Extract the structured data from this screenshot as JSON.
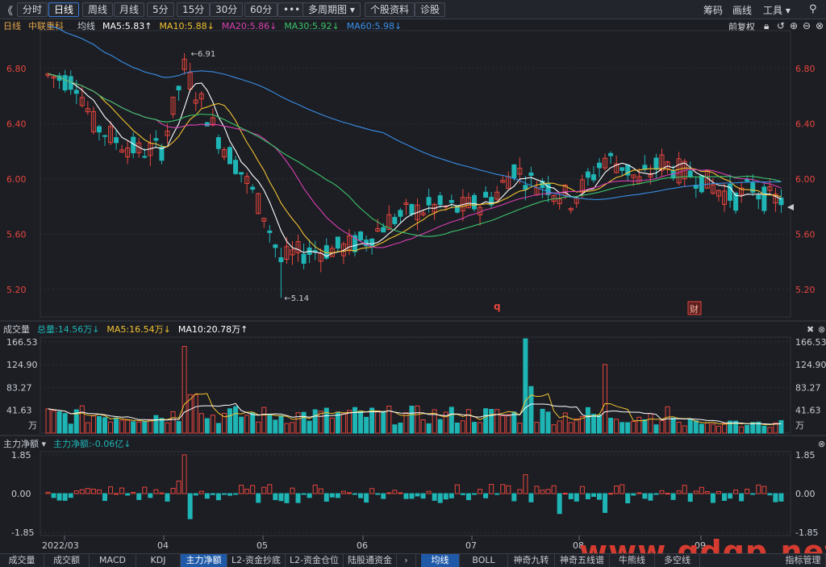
{
  "toolbar": {
    "collapse_glyph": "《",
    "left_buttons": [
      "分时",
      "日线",
      "周线",
      "月线",
      "5分",
      "15分",
      "30分",
      "60分",
      "•••",
      "多周期图 ▾",
      "个股资料",
      "诊股"
    ],
    "active_index": 1,
    "right_labels": [
      "筹码",
      "画线",
      "工具 ▾"
    ]
  },
  "price_legend": {
    "period": "日线",
    "stock_name": "中联重科",
    "ma_label": "均线",
    "ma5": "MA5:5.83↑",
    "ma10": "MA10:5.88↓",
    "ma20": "MA20:5.86↓",
    "ma30": "MA30:5.92↓",
    "ma60": "MA60:5.98↓",
    "adjust": "前复权"
  },
  "volume_legend": {
    "title": "成交量",
    "total": "总量:14.56万↓",
    "ma5": "MA5:16.54万↓",
    "ma10": "MA10:20.78万↑"
  },
  "flow_legend": {
    "title": "主力净额 ▾",
    "value": "主力净额:-0.06亿↓"
  },
  "colors": {
    "up": "#e8453c",
    "down": "#1fb5b5",
    "ma5": "#ffffff",
    "ma10": "#f2c230",
    "ma20": "#d93fb0",
    "ma30": "#3cc46a",
    "ma60": "#3a8ee6",
    "grid": "#2e3138"
  },
  "chart_data": [
    {
      "type": "candlestick",
      "title": "中联重科 日线",
      "ylim": [
        5.0,
        7.05
      ],
      "y_ticks": [
        "6.80",
        "6.40",
        "6.00",
        "5.60",
        "5.20"
      ],
      "x_labels": [
        "2022/03",
        "04",
        "05",
        "06",
        "07",
        "08",
        "09"
      ],
      "annotations": [
        "6.91",
        "5.14"
      ],
      "markers": [
        "q",
        "财"
      ],
      "ma_last": {
        "MA5": 5.83,
        "MA10": 5.88,
        "MA20": 5.86,
        "MA30": 5.92,
        "MA60": 5.98
      }
    },
    {
      "type": "bar",
      "title": "成交量",
      "y_ticks": [
        "166.53",
        "124.90",
        "83.27",
        "41.63"
      ],
      "unit": "万",
      "ylim": [
        0,
        175
      ]
    },
    {
      "type": "bar",
      "title": "主力净额",
      "y_ticks": [
        "1.85",
        "0.00",
        "-1.85"
      ],
      "ylim": [
        -2.0,
        2.0
      ]
    }
  ],
  "bottom_tabs": [
    "成交量",
    "成交额",
    "MACD",
    "KDJ",
    "主力净额",
    "L2-资金抄底",
    "L2-资金仓位",
    "陆股通资金"
  ],
  "bottom_active": 4,
  "bottom_tabs_right": [
    "均线",
    "BOLL",
    "神奇九转",
    "神奇五线谱",
    "牛熊线",
    "多空线",
    "指标管理"
  ],
  "bottom_right_active": 0,
  "watermark": "www.gdgp.net"
}
